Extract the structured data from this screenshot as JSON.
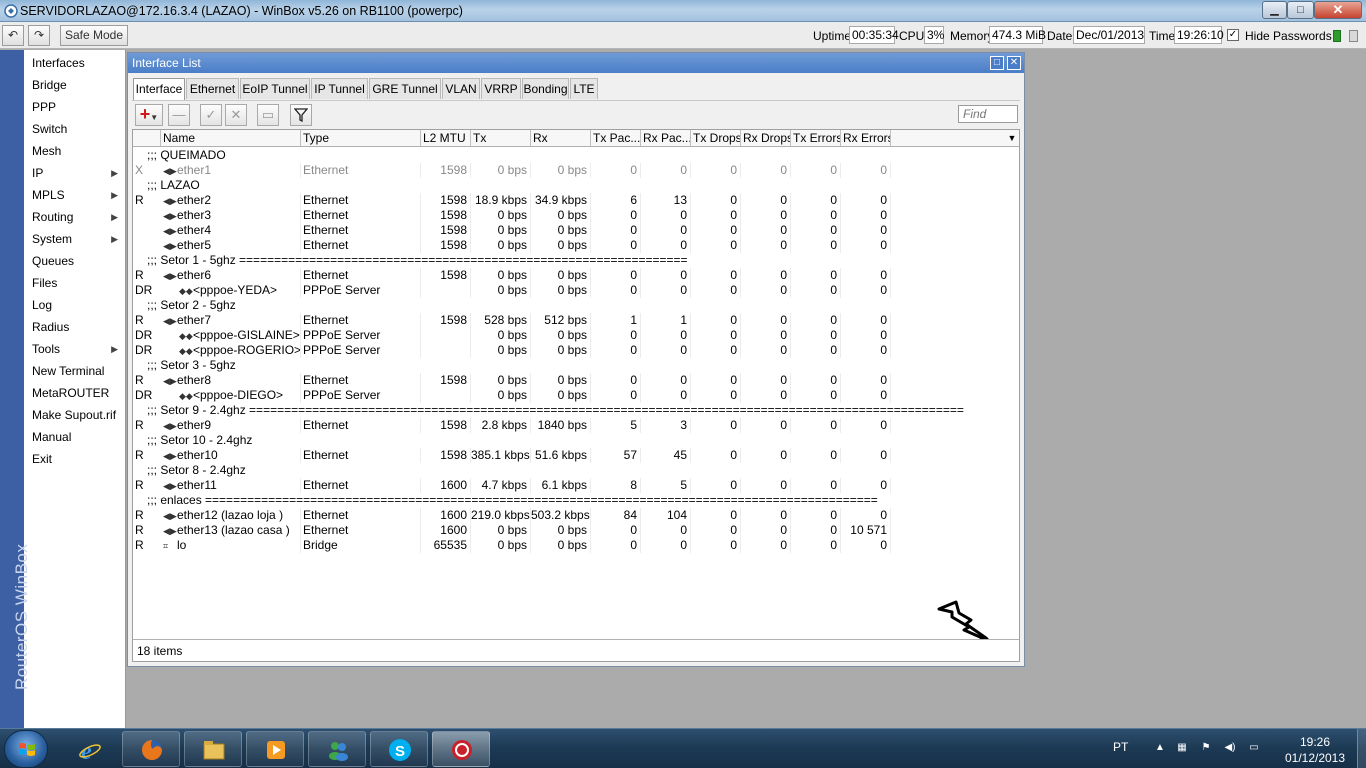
{
  "window": {
    "title": "SERVIDORLAZAO@172.16.3.4 (LAZAO) - WinBox v5.26 on RB1100 (powerpc)",
    "min": "▁",
    "max": "□",
    "close": "✕"
  },
  "toolbar": {
    "safe_mode": "Safe Mode",
    "uptime_label": "Uptime:",
    "uptime": "00:35:34",
    "cpu_label": "CPU:",
    "cpu": "3%",
    "memory_label": "Memory:",
    "memory": "474.3 MiB",
    "date_label": "Date:",
    "date": "Dec/01/2013",
    "time_label": "Time:",
    "time": "19:26:10",
    "hide_passwords": "Hide Passwords",
    "hide_passwords_checked": true
  },
  "sidebar": {
    "brand": "RouterOS WinBox",
    "items": [
      {
        "label": "Interfaces",
        "arrow": false
      },
      {
        "label": "Bridge",
        "arrow": false
      },
      {
        "label": "PPP",
        "arrow": false
      },
      {
        "label": "Switch",
        "arrow": false
      },
      {
        "label": "Mesh",
        "arrow": false
      },
      {
        "label": "IP",
        "arrow": true
      },
      {
        "label": "MPLS",
        "arrow": true
      },
      {
        "label": "Routing",
        "arrow": true
      },
      {
        "label": "System",
        "arrow": true
      },
      {
        "label": "Queues",
        "arrow": false
      },
      {
        "label": "Files",
        "arrow": false
      },
      {
        "label": "Log",
        "arrow": false
      },
      {
        "label": "Radius",
        "arrow": false
      },
      {
        "label": "Tools",
        "arrow": true
      },
      {
        "label": "New Terminal",
        "arrow": false
      },
      {
        "label": "MetaROUTER",
        "arrow": false
      },
      {
        "label": "Make Supout.rif",
        "arrow": false
      },
      {
        "label": "Manual",
        "arrow": false
      },
      {
        "label": "Exit",
        "arrow": false
      }
    ]
  },
  "interface_window": {
    "title": "Interface List",
    "tabs": [
      "Interface",
      "Ethernet",
      "EoIP Tunnel",
      "IP Tunnel",
      "GRE Tunnel",
      "VLAN",
      "VRRP",
      "Bonding",
      "LTE"
    ],
    "active_tab": 0,
    "find_placeholder": "Find",
    "status": "18 items",
    "columns": [
      "Name",
      "Type",
      "L2 MTU",
      "Tx",
      "Rx",
      "Tx Pac...",
      "Rx Pac...",
      "Tx Drops",
      "Rx Drops",
      "Tx Errors",
      "Rx Errors"
    ],
    "rows": [
      {
        "section": ";;; QUEIMADO"
      },
      {
        "flag": "X",
        "name": "ether1",
        "type": "Ethernet",
        "mtu": "1598",
        "tx": "0 bps",
        "rx": "0 bps",
        "txp": "0",
        "rxp": "0",
        "txd": "0",
        "rxd": "0",
        "txe": "0",
        "rxe": "0",
        "disabled": true
      },
      {
        "section": ";;; LAZAO"
      },
      {
        "flag": "R",
        "name": "ether2",
        "type": "Ethernet",
        "mtu": "1598",
        "tx": "18.9 kbps",
        "rx": "34.9 kbps",
        "txp": "6",
        "rxp": "13",
        "txd": "0",
        "rxd": "0",
        "txe": "0",
        "rxe": "0"
      },
      {
        "flag": "",
        "name": "ether3",
        "type": "Ethernet",
        "mtu": "1598",
        "tx": "0 bps",
        "rx": "0 bps",
        "txp": "0",
        "rxp": "0",
        "txd": "0",
        "rxd": "0",
        "txe": "0",
        "rxe": "0"
      },
      {
        "flag": "",
        "name": "ether4",
        "type": "Ethernet",
        "mtu": "1598",
        "tx": "0 bps",
        "rx": "0 bps",
        "txp": "0",
        "rxp": "0",
        "txd": "0",
        "rxd": "0",
        "txe": "0",
        "rxe": "0"
      },
      {
        "flag": "",
        "name": "ether5",
        "type": "Ethernet",
        "mtu": "1598",
        "tx": "0 bps",
        "rx": "0 bps",
        "txp": "0",
        "rxp": "0",
        "txd": "0",
        "rxd": "0",
        "txe": "0",
        "rxe": "0"
      },
      {
        "section": ";;; Setor 1 - 5ghz ================================================================"
      },
      {
        "flag": "R",
        "name": "ether6",
        "type": "Ethernet",
        "mtu": "1598",
        "tx": "0 bps",
        "rx": "0 bps",
        "txp": "0",
        "rxp": "0",
        "txd": "0",
        "rxd": "0",
        "txe": "0",
        "rxe": "0"
      },
      {
        "flag": "DR",
        "name": "<pppoe-YEDA>",
        "type": "PPPoE Server",
        "mtu": "",
        "tx": "0 bps",
        "rx": "0 bps",
        "txp": "0",
        "rxp": "0",
        "txd": "0",
        "rxd": "0",
        "txe": "0",
        "rxe": "0",
        "child": true
      },
      {
        "section": ";;; Setor 2 - 5ghz"
      },
      {
        "flag": "R",
        "name": "ether7",
        "type": "Ethernet",
        "mtu": "1598",
        "tx": "528 bps",
        "rx": "512 bps",
        "txp": "1",
        "rxp": "1",
        "txd": "0",
        "rxd": "0",
        "txe": "0",
        "rxe": "0"
      },
      {
        "flag": "DR",
        "name": "<pppoe-GISLAINE>",
        "type": "PPPoE Server",
        "mtu": "",
        "tx": "0 bps",
        "rx": "0 bps",
        "txp": "0",
        "rxp": "0",
        "txd": "0",
        "rxd": "0",
        "txe": "0",
        "rxe": "0",
        "child": true
      },
      {
        "flag": "DR",
        "name": "<pppoe-ROGERIO>",
        "type": "PPPoE Server",
        "mtu": "",
        "tx": "0 bps",
        "rx": "0 bps",
        "txp": "0",
        "rxp": "0",
        "txd": "0",
        "rxd": "0",
        "txe": "0",
        "rxe": "0",
        "child": true
      },
      {
        "section": ";;; Setor 3 - 5ghz"
      },
      {
        "flag": "R",
        "name": "ether8",
        "type": "Ethernet",
        "mtu": "1598",
        "tx": "0 bps",
        "rx": "0 bps",
        "txp": "0",
        "rxp": "0",
        "txd": "0",
        "rxd": "0",
        "txe": "0",
        "rxe": "0"
      },
      {
        "flag": "DR",
        "name": "<pppoe-DIEGO>",
        "type": "PPPoE Server",
        "mtu": "",
        "tx": "0 bps",
        "rx": "0 bps",
        "txp": "0",
        "rxp": "0",
        "txd": "0",
        "rxd": "0",
        "txe": "0",
        "rxe": "0",
        "child": true
      },
      {
        "section": ";;; Setor 9 - 2.4ghz ======================================================================================================"
      },
      {
        "flag": "R",
        "name": "ether9",
        "type": "Ethernet",
        "mtu": "1598",
        "tx": "2.8 kbps",
        "rx": "1840 bps",
        "txp": "5",
        "rxp": "3",
        "txd": "0",
        "rxd": "0",
        "txe": "0",
        "rxe": "0"
      },
      {
        "section": ";;; Setor 10 - 2.4ghz"
      },
      {
        "flag": "R",
        "name": "ether10",
        "type": "Ethernet",
        "mtu": "1598",
        "tx": "385.1 kbps",
        "rx": "51.6 kbps",
        "txp": "57",
        "rxp": "45",
        "txd": "0",
        "rxd": "0",
        "txe": "0",
        "rxe": "0"
      },
      {
        "section": ";;; Setor 8 - 2.4ghz"
      },
      {
        "flag": "R",
        "name": "ether11",
        "type": "Ethernet",
        "mtu": "1600",
        "tx": "4.7 kbps",
        "rx": "6.1 kbps",
        "txp": "8",
        "rxp": "5",
        "txd": "0",
        "rxd": "0",
        "txe": "0",
        "rxe": "0"
      },
      {
        "section": ";;; enlaces ================================================================================================"
      },
      {
        "flag": "R",
        "name": "ether12 (lazao loja )",
        "type": "Ethernet",
        "mtu": "1600",
        "tx": "219.0 kbps",
        "rx": "503.2 kbps",
        "txp": "84",
        "rxp": "104",
        "txd": "0",
        "rxd": "0",
        "txe": "0",
        "rxe": "0"
      },
      {
        "flag": "R",
        "name": "ether13 (lazao casa )",
        "type": "Ethernet",
        "mtu": "1600",
        "tx": "0 bps",
        "rx": "0 bps",
        "txp": "0",
        "rxp": "0",
        "txd": "0",
        "rxd": "0",
        "txe": "0",
        "rxe": "10 571"
      },
      {
        "flag": "R",
        "name": "lo",
        "type": "Bridge",
        "mtu": "65535",
        "tx": "0 bps",
        "rx": "0 bps",
        "txp": "0",
        "rxp": "0",
        "txd": "0",
        "rxd": "0",
        "txe": "0",
        "rxe": "0",
        "loopback": true
      }
    ]
  },
  "taskbar": {
    "language": "PT",
    "clock_time": "19:26",
    "clock_date": "01/12/2013",
    "items": [
      "internet-explorer-icon",
      "firefox-icon",
      "file-explorer-icon",
      "media-player-icon",
      "messenger-icon",
      "skype-icon",
      "winbox-icon"
    ]
  },
  "colors": {
    "titlebar": "#a3c1df",
    "window_title": "#4b7ec8",
    "sidebar_brand": "#3d5fa3",
    "taskbar": "#1c3953"
  }
}
